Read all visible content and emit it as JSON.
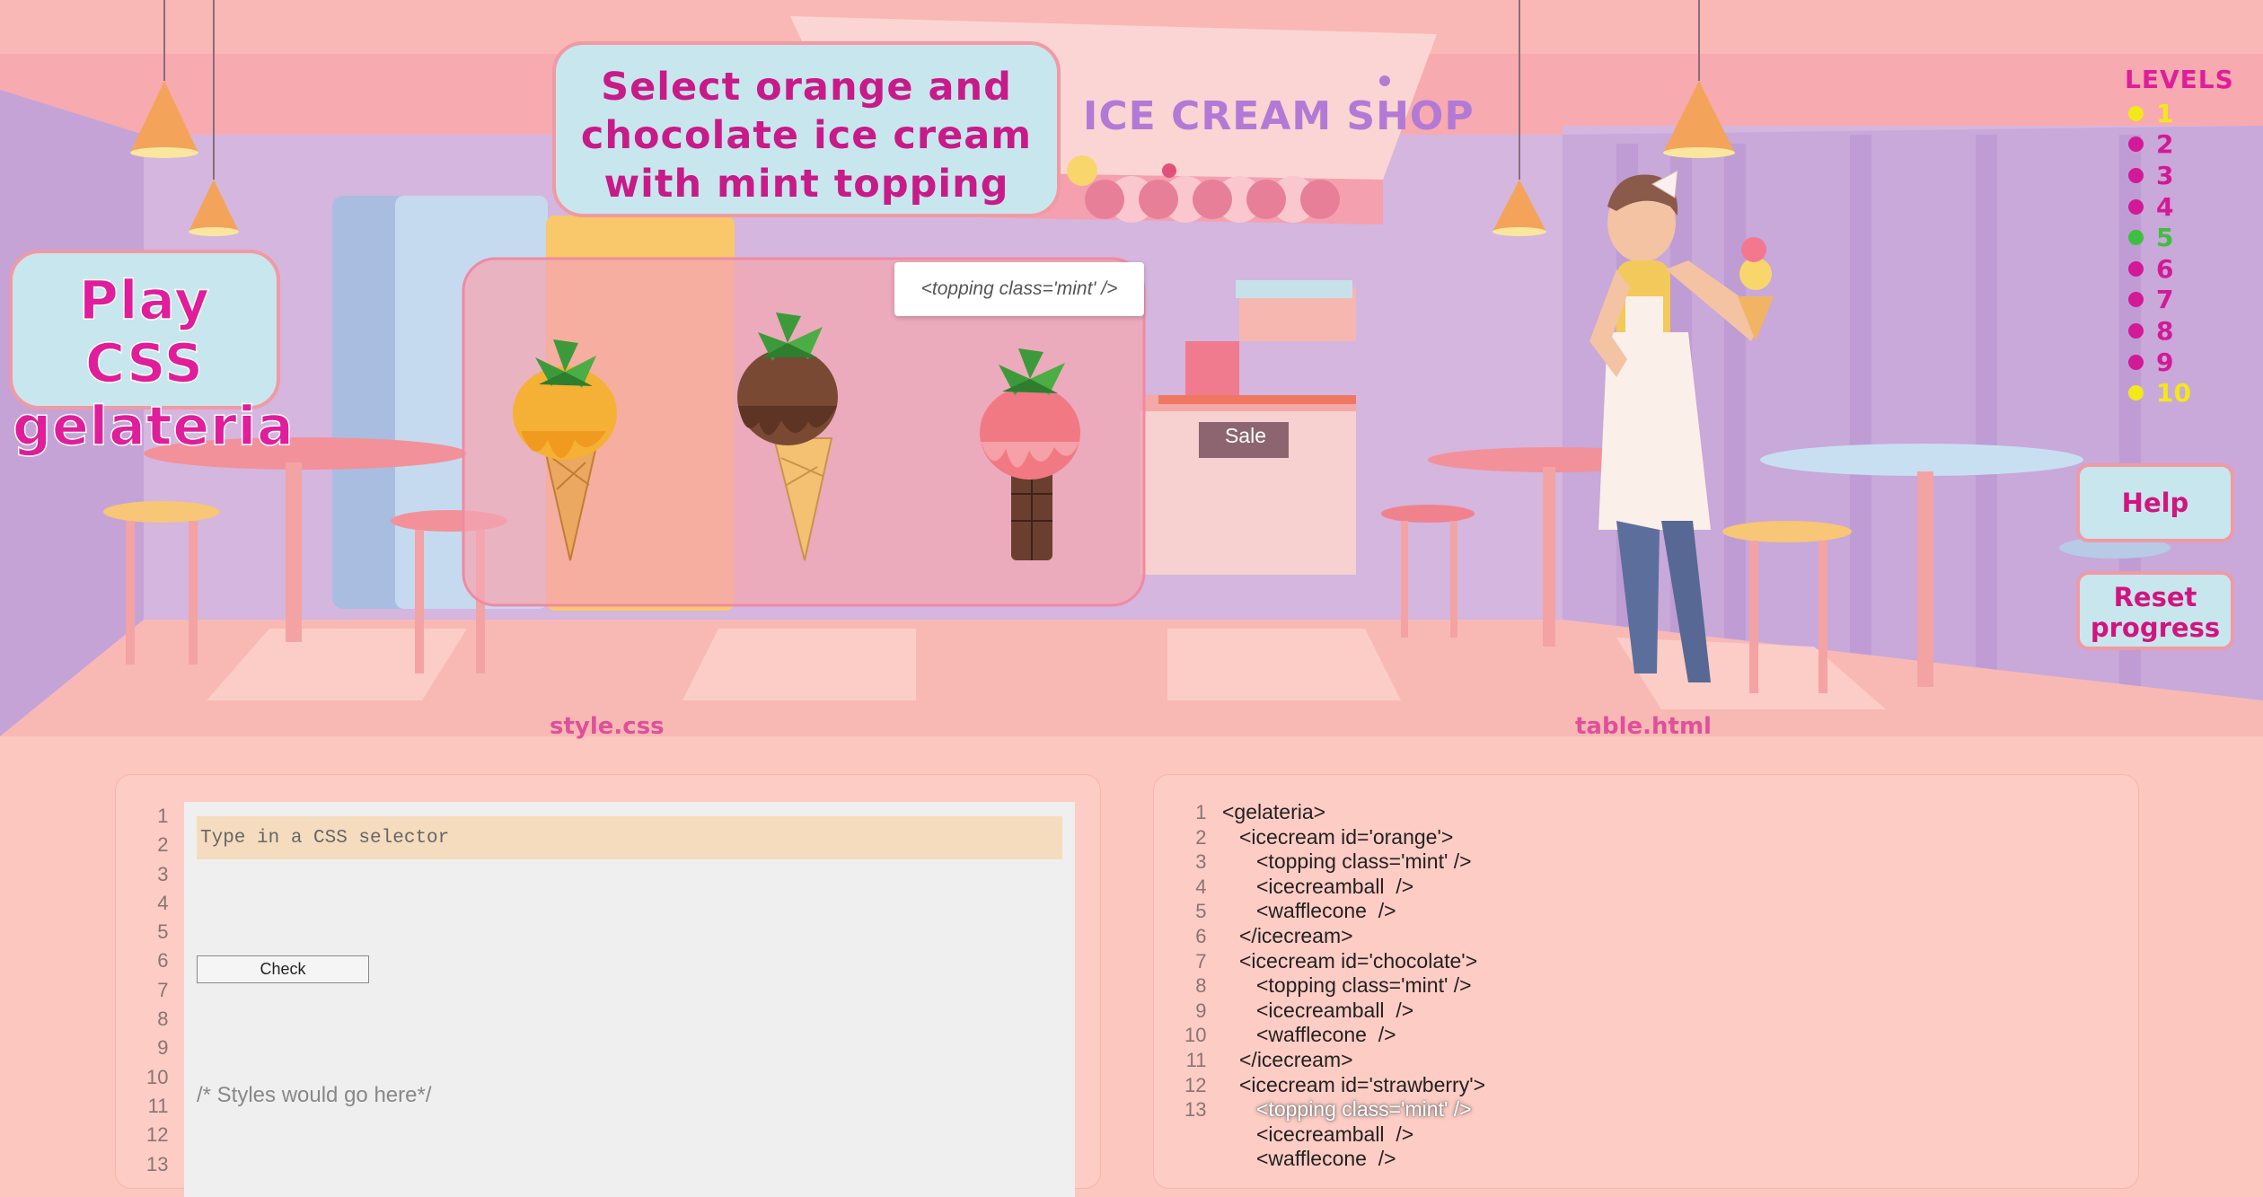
{
  "game_title": "Play CSS gelateria",
  "instruction": "Select orange and chocolate ice cream with mint topping",
  "shop_sign": "ICE CREAM SHOP",
  "sale_sign": "Sale",
  "tooltip": "<topping class='mint' />",
  "levels": {
    "title": "LEVELS",
    "items": [
      {
        "num": "1",
        "color": "#f2e81a"
      },
      {
        "num": "2",
        "color": "#d21a96"
      },
      {
        "num": "3",
        "color": "#d21a96"
      },
      {
        "num": "4",
        "color": "#d21a96"
      },
      {
        "num": "5",
        "color": "#3fbf3f"
      },
      {
        "num": "6",
        "color": "#d21a96"
      },
      {
        "num": "7",
        "color": "#d21a96"
      },
      {
        "num": "8",
        "color": "#d21a96"
      },
      {
        "num": "9",
        "color": "#d21a96"
      },
      {
        "num": "10",
        "color": "#f2e81a"
      }
    ]
  },
  "help_button": "Help",
  "reset_button": "Reset progress",
  "css_file": "style.css",
  "html_file": "table.html",
  "editor": {
    "placeholder": "Type in a CSS selector",
    "check_label": "Check",
    "comment": "/* Styles would go here*/"
  },
  "line_numbers": [
    "1",
    "2",
    "3",
    "4",
    "5",
    "6",
    "7",
    "8",
    "9",
    "10",
    "11",
    "12",
    "13"
  ],
  "html_code": [
    {
      "text": "<gelateria>",
      "indent": 0
    },
    {
      "text": "<icecream id='orange'>",
      "indent": 1
    },
    {
      "text": "<topping class='mint' />",
      "indent": 2
    },
    {
      "text": "<icecreamball  />",
      "indent": 2
    },
    {
      "text": "<wafflecone  />",
      "indent": 2
    },
    {
      "text": "</icecream>",
      "indent": 1
    },
    {
      "text": "<icecream id='chocolate'>",
      "indent": 1
    },
    {
      "text": "<topping class='mint' />",
      "indent": 2
    },
    {
      "text": "<icecreamball  />",
      "indent": 2
    },
    {
      "text": "<wafflecone  />",
      "indent": 2
    },
    {
      "text": "</icecream>",
      "indent": 1
    },
    {
      "text": "<icecream id='strawberry'>",
      "indent": 1
    },
    {
      "text": "<topping class='mint' />",
      "indent": 2,
      "highlight": true
    },
    {
      "text": "<icecreamball  />",
      "indent": 2
    },
    {
      "text": "<wafflecone  />",
      "indent": 2
    }
  ],
  "colors": {
    "pink_title": "#d2147e",
    "panel_bg": "#fdccc4",
    "button_bg": "#c8e6ee"
  }
}
